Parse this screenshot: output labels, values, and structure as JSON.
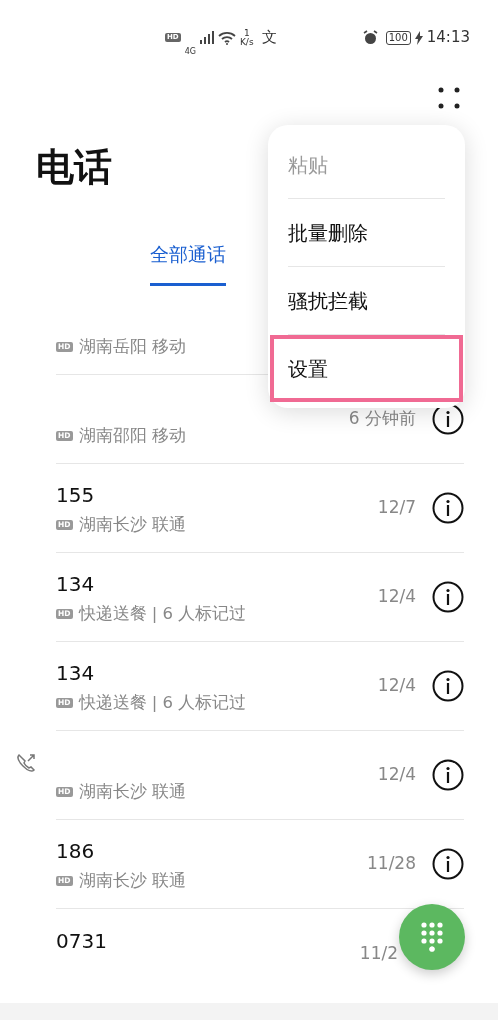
{
  "status_bar": {
    "hd": "HD",
    "network": "4G",
    "speed_value": "1",
    "speed_unit": "K/s",
    "ime": "文",
    "battery": "100",
    "time": "14:13"
  },
  "title": "电话",
  "tabs": [
    {
      "label": "全部通话",
      "selected": true
    }
  ],
  "calls": [
    {
      "location": "湖南岳阳 移动",
      "badge": "HD",
      "outgoing": false
    },
    {
      "location": "湖南邵阳 移动",
      "badge": "HD",
      "time": "6 分钟前",
      "outgoing": false
    },
    {
      "number": "155",
      "location": "湖南长沙 联通",
      "badge": "HD",
      "time": "12/7",
      "outgoing": false
    },
    {
      "number": "134",
      "location": "快递送餐 | 6 人标记过",
      "badge": "HD",
      "time": "12/4",
      "outgoing": false
    },
    {
      "number": "134",
      "location": "快递送餐 | 6 人标记过",
      "badge": "HD",
      "time": "12/4",
      "outgoing": false
    },
    {
      "location": "湖南长沙 联通",
      "badge": "HD",
      "time": "12/4",
      "outgoing": true
    },
    {
      "number": "186",
      "location": "湖南长沙 联通",
      "badge": "HD",
      "time": "11/28",
      "outgoing": false
    },
    {
      "number": "0731",
      "time": "11/2",
      "outgoing": false
    }
  ],
  "menu": [
    {
      "label": "粘贴",
      "disabled": true,
      "highlighted": false
    },
    {
      "label": "批量删除",
      "disabled": false,
      "highlighted": false
    },
    {
      "label": "骚扰拦截",
      "disabled": false,
      "highlighted": false
    },
    {
      "label": "设置",
      "disabled": false,
      "highlighted": true
    }
  ]
}
